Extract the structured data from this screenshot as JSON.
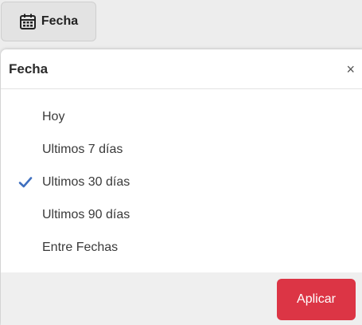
{
  "trigger": {
    "label": "Fecha",
    "icon": "calendar-icon"
  },
  "popover": {
    "title": "Fecha",
    "close_label": "×",
    "options": [
      {
        "label": "Hoy",
        "selected": false
      },
      {
        "label": "Ultimos 7 días",
        "selected": false
      },
      {
        "label": "Ultimos 30 días",
        "selected": true
      },
      {
        "label": "Ultimos 90 días",
        "selected": false
      },
      {
        "label": "Entre Fechas",
        "selected": false
      }
    ],
    "apply_label": "Aplicar"
  },
  "colors": {
    "accent_check": "#3f6fbf",
    "apply_button": "#dc3545"
  }
}
